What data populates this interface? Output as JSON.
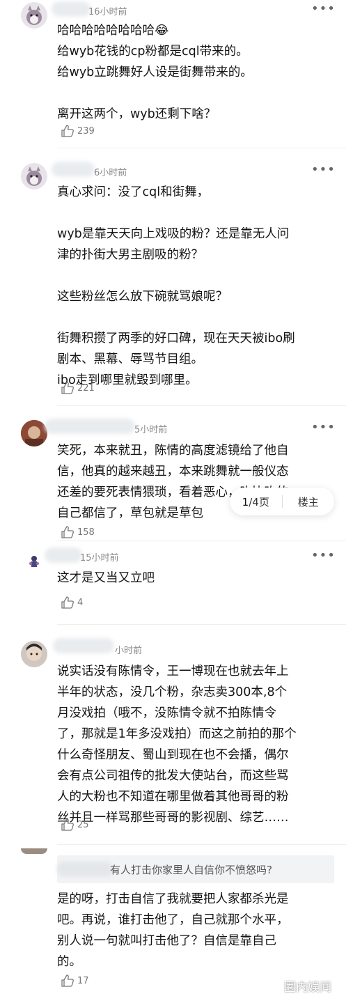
{
  "comments": [
    {
      "time": "16小时前",
      "lines": "哈哈哈哈哈哈哈哈😂\n给wyb花钱的cp粉都是cql带来的。\n给wyb立跳舞好人设是街舞带来的。\n\n离开这两个，wyb还剩下啥？",
      "likes": "239"
    },
    {
      "time": "6小时前",
      "lines": "真心求问：没了cql和街舞，\n\nwyb是靠天天向上戏吸的粉？还是靠无人问\n津的扑街大男主剧吸的粉？\n\n这些粉丝怎么放下碗就骂娘呢？\n\n街舞积攒了两季的好口碑，现在天天被ibo刷\n剧本、黑幕、辱骂节目组。\nibo走到哪里就毁到哪里。",
      "likes": "221"
    },
    {
      "time": "5小时前",
      "lines": "笑死，本来就丑，陈情的高度滤镜给了他自\n信，他真的越来越丑，本来跳舞就一般仪态\n还差的要死表情猥琐，看着恶心，吹比吹的\n自己都信了，草包就是草包",
      "likes": "158"
    },
    {
      "time": "15小时前",
      "lines": "这才是又当又立吧",
      "likes": "4"
    },
    {
      "time": "小时前",
      "lines": "说实话没有陈情令，王一博现在也就去年上\n半年的状态，没几个粉，杂志卖300本,8个\n月没戏拍（哦不，没陈情令就不拍陈情令\n了，那就是1年多没戏拍）而这之前拍的那个\n什么奇怪朋友、蜀山到现在也不会播，偶尔\n会有点公司祖传的批发大使站台，而这些骂\n人的大粉也不知道在哪里做着其他哥哥的粉\n丝并且一样骂那些哥哥的影视剧、综艺……",
      "likes": "25"
    },
    {
      "quote": "有人打击你家里人自信你不愤怒吗?",
      "lines": "是的呀，打击自信了我就要把人家都杀光是\n吧。再说，谁打击他了，自己就那个水平，\n别人说一句就叫打击他了？自信是靠自己\n的。",
      "likes": "17"
    }
  ],
  "pager": {
    "current": "1",
    "total": "/4页",
    "host_label": "楼主"
  },
  "more_glyph": "•••",
  "watermark": "圈内娱闻",
  "colors": {
    "text": "#141414",
    "meta": "#8a8a8a",
    "quote_bg": "#f2f3f5"
  }
}
